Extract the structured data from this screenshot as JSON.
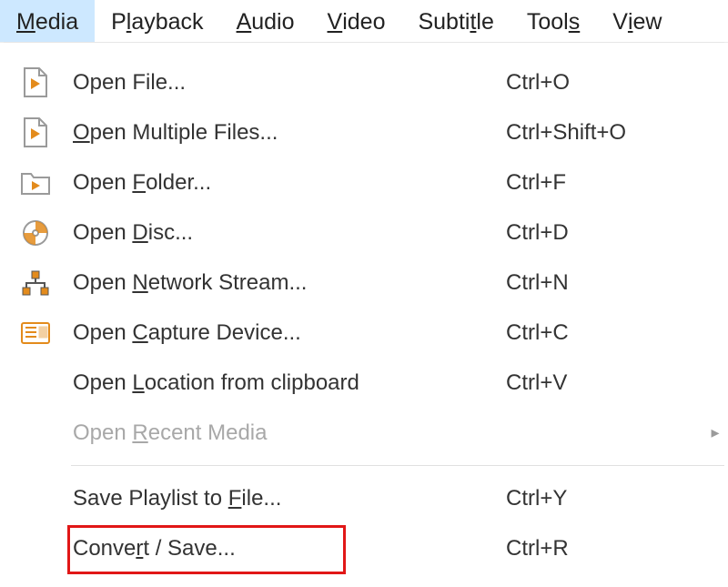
{
  "menubar": {
    "items": [
      {
        "pre": "",
        "u": "M",
        "post": "edia",
        "selected": true
      },
      {
        "pre": "P",
        "u": "l",
        "post": "ayback",
        "selected": false
      },
      {
        "pre": "",
        "u": "A",
        "post": "udio",
        "selected": false
      },
      {
        "pre": "",
        "u": "V",
        "post": "ideo",
        "selected": false
      },
      {
        "pre": "Subti",
        "u": "t",
        "post": "le",
        "selected": false
      },
      {
        "pre": "Tool",
        "u": "s",
        "post": "",
        "selected": false
      },
      {
        "pre": "V",
        "u": "i",
        "post": "ew",
        "selected": false
      }
    ]
  },
  "menu": {
    "items": [
      {
        "icon": "file-play",
        "pre": "Open File...",
        "u": "",
        "post": "",
        "shortcut": "Ctrl+O",
        "arrow": false,
        "disabled": false,
        "highlight": false
      },
      {
        "icon": "file-play",
        "pre": "",
        "u": "O",
        "post": "pen Multiple Files...",
        "shortcut": "Ctrl+Shift+O",
        "arrow": false,
        "disabled": false,
        "highlight": false
      },
      {
        "icon": "folder-play",
        "pre": "Open ",
        "u": "F",
        "post": "older...",
        "shortcut": "Ctrl+F",
        "arrow": false,
        "disabled": false,
        "highlight": false
      },
      {
        "icon": "disc",
        "pre": "Open ",
        "u": "D",
        "post": "isc...",
        "shortcut": "Ctrl+D",
        "arrow": false,
        "disabled": false,
        "highlight": false
      },
      {
        "icon": "network",
        "pre": "Open ",
        "u": "N",
        "post": "etwork Stream...",
        "shortcut": "Ctrl+N",
        "arrow": false,
        "disabled": false,
        "highlight": false
      },
      {
        "icon": "capture",
        "pre": "Open ",
        "u": "C",
        "post": "apture Device...",
        "shortcut": "Ctrl+C",
        "arrow": false,
        "disabled": false,
        "highlight": false
      },
      {
        "icon": "none",
        "pre": "Open ",
        "u": "L",
        "post": "ocation from clipboard",
        "shortcut": "Ctrl+V",
        "arrow": false,
        "disabled": false,
        "highlight": false
      },
      {
        "icon": "none",
        "pre": "Open ",
        "u": "R",
        "post": "ecent Media",
        "shortcut": "",
        "arrow": true,
        "disabled": true,
        "highlight": false
      },
      {
        "separator": true
      },
      {
        "icon": "none",
        "pre": "Save Playlist to ",
        "u": "F",
        "post": "ile...",
        "shortcut": "Ctrl+Y",
        "arrow": false,
        "disabled": false,
        "highlight": false
      },
      {
        "icon": "none",
        "pre": "Conve",
        "u": "r",
        "post": "t / Save...",
        "shortcut": "Ctrl+R",
        "arrow": false,
        "disabled": false,
        "highlight": true
      }
    ]
  },
  "colors": {
    "menubar_selected_bg": "#cde8ff",
    "highlight_border": "#e11717",
    "cone_orange": "#e38b1c"
  }
}
